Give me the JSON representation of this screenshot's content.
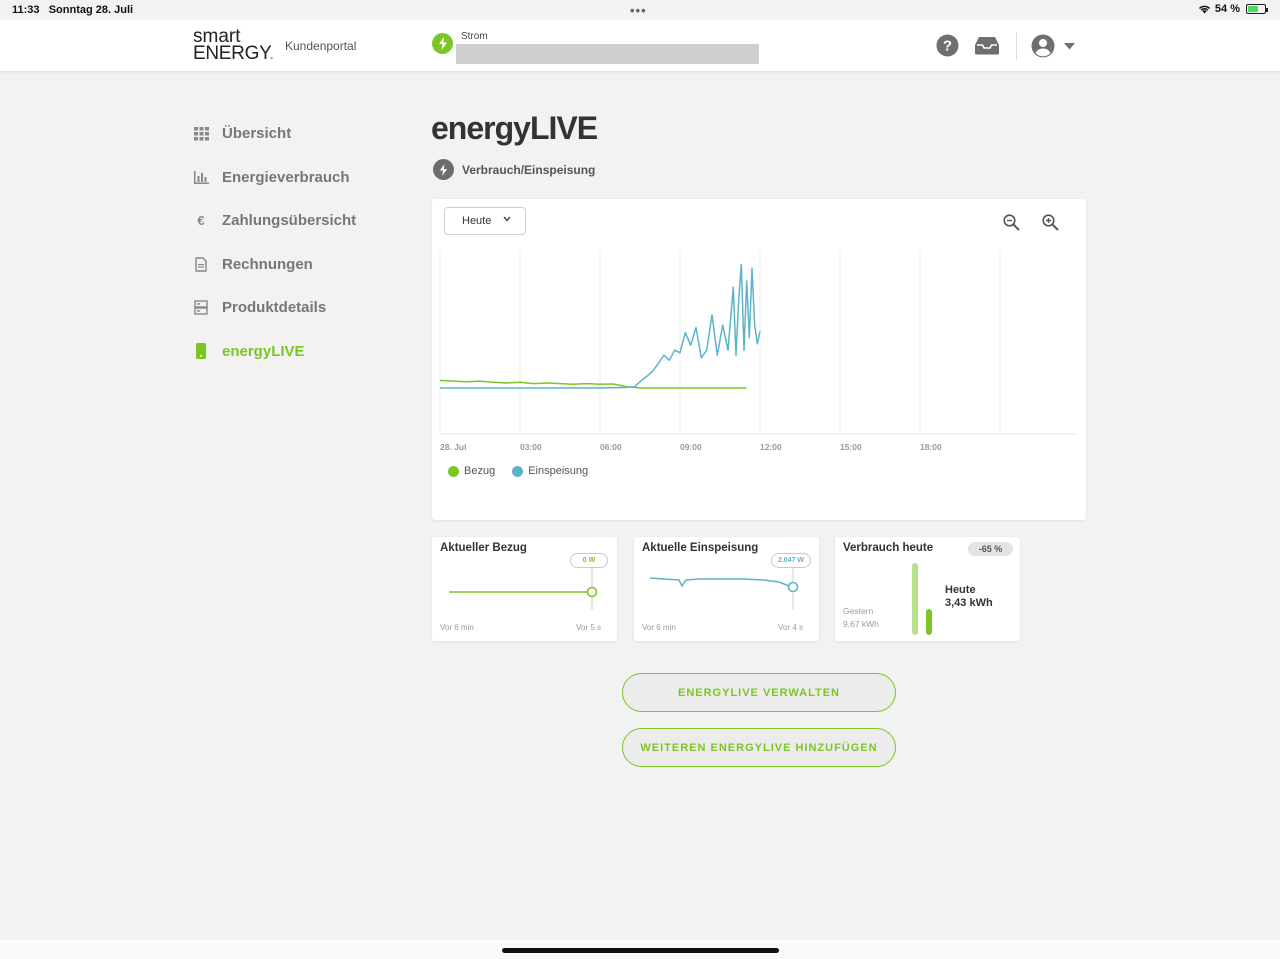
{
  "status_bar": {
    "time": "11:33",
    "date": "Sonntag 28. Juli",
    "battery": "54 %",
    "battery_level": 0.54
  },
  "header": {
    "logo_line1": "smart",
    "logo_line2": "ENERGY",
    "logo_dot": ".",
    "portal_label": "Kundenportal",
    "contract_type": "Strom",
    "icons": [
      "help-icon",
      "inbox-icon",
      "account-icon",
      "chevron-down-icon"
    ]
  },
  "sidebar": {
    "items": [
      {
        "label": "Übersicht",
        "icon": "grid-icon",
        "active": false
      },
      {
        "label": "Energieverbrauch",
        "icon": "bar-chart-icon",
        "active": false
      },
      {
        "label": "Zahlungsübersicht",
        "icon": "euro-icon",
        "active": false
      },
      {
        "label": "Rechnungen",
        "icon": "document-icon",
        "active": false
      },
      {
        "label": "Produktdetails",
        "icon": "product-icon",
        "active": false
      },
      {
        "label": "energyLIVE",
        "icon": "device-icon",
        "active": true
      }
    ]
  },
  "main": {
    "title": "energyLIVE",
    "subtitle": "Verbrauch/Einspeisung",
    "period": "Heute",
    "zoom_icons": [
      "zoom-out-icon",
      "zoom-in-icon"
    ]
  },
  "colors": {
    "accent": "#7cc624",
    "bezug": "#7cc624",
    "einspeisung": "#5fb3c9"
  },
  "chart_data": {
    "type": "line",
    "x_ticks": [
      "28. Jul",
      "03:00",
      "06:00",
      "09:00",
      "12:00",
      "15:00",
      "18:00"
    ],
    "x_unit": "hours",
    "xlim": [
      0,
      24
    ],
    "ylim": [
      0,
      100
    ],
    "y_unit": "relative",
    "grid": true,
    "legend_position": "bottom-left",
    "series": [
      {
        "name": "Bezug",
        "color": "#7cc624",
        "points": [
          [
            0,
            6
          ],
          [
            0.5,
            5.5
          ],
          [
            1,
            5
          ],
          [
            1.5,
            5.5
          ],
          [
            2,
            4.5
          ],
          [
            2.5,
            4
          ],
          [
            3,
            4.5
          ],
          [
            3.5,
            3.5
          ],
          [
            4,
            4
          ],
          [
            4.5,
            3.5
          ],
          [
            5,
            3
          ],
          [
            5.5,
            3.5
          ],
          [
            6,
            3
          ],
          [
            6.5,
            3.2
          ],
          [
            7,
            1
          ],
          [
            7.3,
            0.5
          ],
          [
            7.5,
            0
          ],
          [
            8,
            0
          ],
          [
            9,
            0
          ],
          [
            10,
            0
          ],
          [
            11,
            0
          ],
          [
            11.5,
            0
          ]
        ]
      },
      {
        "name": "Einspeisung",
        "color": "#5fb3c9",
        "points": [
          [
            0,
            0
          ],
          [
            6,
            0
          ],
          [
            7,
            0.5
          ],
          [
            7.3,
            1
          ],
          [
            7.5,
            5
          ],
          [
            7.8,
            10
          ],
          [
            8,
            14
          ],
          [
            8.2,
            20
          ],
          [
            8.4,
            26
          ],
          [
            8.6,
            22
          ],
          [
            8.8,
            30
          ],
          [
            9,
            28
          ],
          [
            9.2,
            44
          ],
          [
            9.4,
            34
          ],
          [
            9.6,
            48
          ],
          [
            9.8,
            24
          ],
          [
            10,
            30
          ],
          [
            10.2,
            58
          ],
          [
            10.4,
            26
          ],
          [
            10.6,
            50
          ],
          [
            10.8,
            30
          ],
          [
            11,
            80
          ],
          [
            11.1,
            26
          ],
          [
            11.2,
            70
          ],
          [
            11.3,
            98
          ],
          [
            11.4,
            30
          ],
          [
            11.5,
            85
          ],
          [
            11.6,
            40
          ],
          [
            11.7,
            95
          ],
          [
            11.8,
            50
          ],
          [
            11.9,
            35
          ],
          [
            12,
            45
          ]
        ]
      }
    ]
  },
  "stats": {
    "bezug": {
      "title": "Aktueller Bezug",
      "value": "0 W",
      "from": "Vor 6 min",
      "to": "Vor 5 s"
    },
    "einspeisung": {
      "title": "Aktuelle Einspeisung",
      "value": "2.047 W",
      "from": "Vor 6 min",
      "to": "Vor 4 s"
    },
    "verbrauch": {
      "title": "Verbrauch heute",
      "change": "-65 %",
      "yesterday_label": "Gestern",
      "yesterday_value": "9,67 kWh",
      "today_label": "Heute",
      "today_value": "3,43 kWh",
      "yesterday_kwh": 9.67,
      "today_kwh": 3.43
    }
  },
  "buttons": {
    "manage": "ENERGYLIVE VERWALTEN",
    "add": "WEITEREN ENERGYLIVE HINZUFÜGEN"
  }
}
